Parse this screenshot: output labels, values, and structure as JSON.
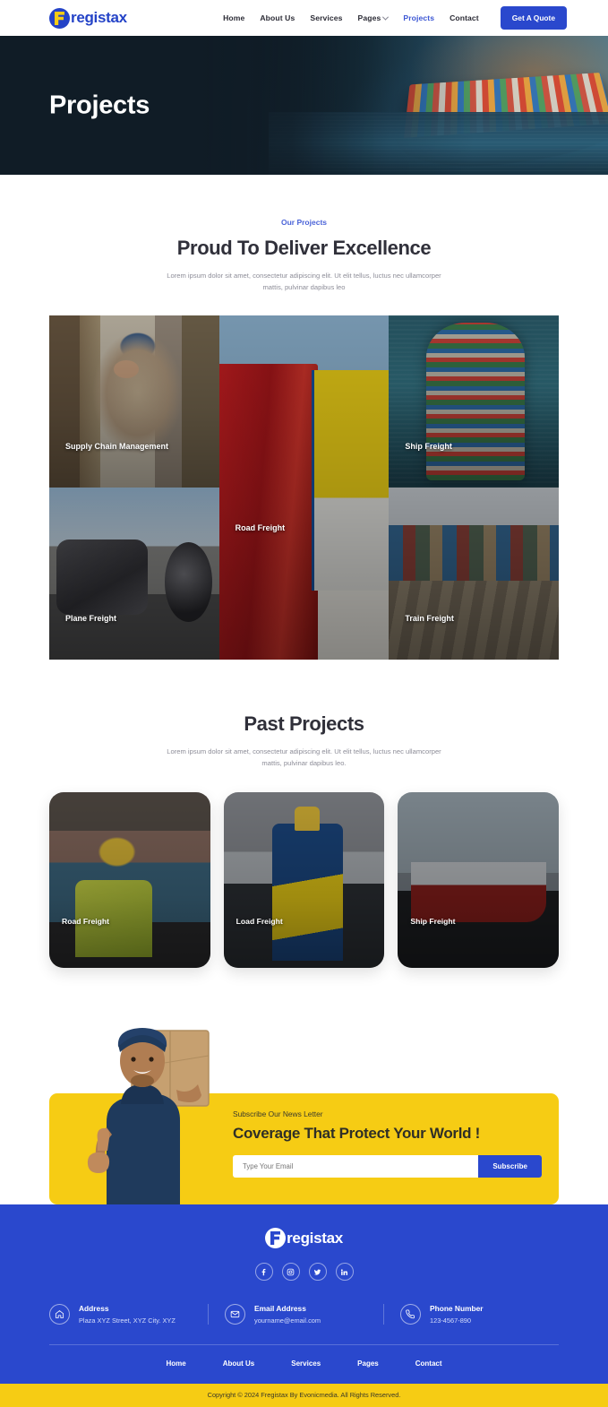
{
  "brand": {
    "name": "registax",
    "mark_letter": "F"
  },
  "header": {
    "nav": [
      {
        "label": "Home",
        "active": false,
        "caret": false
      },
      {
        "label": "About Us",
        "active": false,
        "caret": false
      },
      {
        "label": "Services",
        "active": false,
        "caret": false
      },
      {
        "label": "Pages",
        "active": false,
        "caret": true
      },
      {
        "label": "Projects",
        "active": true,
        "caret": false
      },
      {
        "label": "Contact",
        "active": false,
        "caret": false
      }
    ],
    "cta_label": "Get A Quote"
  },
  "hero": {
    "title": "Projects"
  },
  "projects_section": {
    "eyebrow": "Our Projects",
    "title": "Proud To Deliver Excellence",
    "subtitle": "Lorem ipsum dolor sit amet, consectetur adipiscing elit. Ut elit tellus, luctus nec ullamcorper mattis, pulvinar dapibus leo",
    "tiles": [
      {
        "label": "Supply Chain Management"
      },
      {
        "label": "Road Freight"
      },
      {
        "label": "Ship Freight"
      },
      {
        "label": "Plane Freight"
      },
      {
        "label": "Train Freight"
      }
    ]
  },
  "past_section": {
    "title": "Past Projects",
    "subtitle": "Lorem ipsum dolor sit amet, consectetur adipiscing elit. Ut elit tellus, luctus nec ullamcorper mattis, pulvinar dapibus leo.",
    "cards": [
      {
        "label": "Road Freight"
      },
      {
        "label": "Load Freight"
      },
      {
        "label": "Ship Freight"
      }
    ]
  },
  "newsletter": {
    "kicker": "Subscribe Our News Letter",
    "headline": "Coverage That Protect Your World !",
    "email_placeholder": "Type Your Email",
    "email_value": "",
    "submit_label": "Subscribe"
  },
  "footer": {
    "socials": [
      {
        "name": "facebook-icon"
      },
      {
        "name": "instagram-icon"
      },
      {
        "name": "twitter-icon"
      },
      {
        "name": "linkedin-icon"
      }
    ],
    "contacts": [
      {
        "icon": "home-icon",
        "title": "Address",
        "value": "Plaza XYZ Street, XYZ City. XYZ"
      },
      {
        "icon": "envelope-icon",
        "title": "Email Address",
        "value": "yourname@email.com"
      },
      {
        "icon": "phone-icon",
        "title": "Phone Number",
        "value": "123-4567-890"
      }
    ],
    "nav": [
      {
        "label": "Home"
      },
      {
        "label": "About Us"
      },
      {
        "label": "Services"
      },
      {
        "label": "Pages"
      },
      {
        "label": "Contact"
      }
    ],
    "copyright": "Copyright © 2024 Fregistax By Evonicmedia. All Rights Reserved."
  },
  "colors": {
    "primary_blue": "#2a48cd",
    "accent_yellow": "#f6cc14",
    "dark_text": "#30303a",
    "muted_text": "#8d8d98"
  }
}
